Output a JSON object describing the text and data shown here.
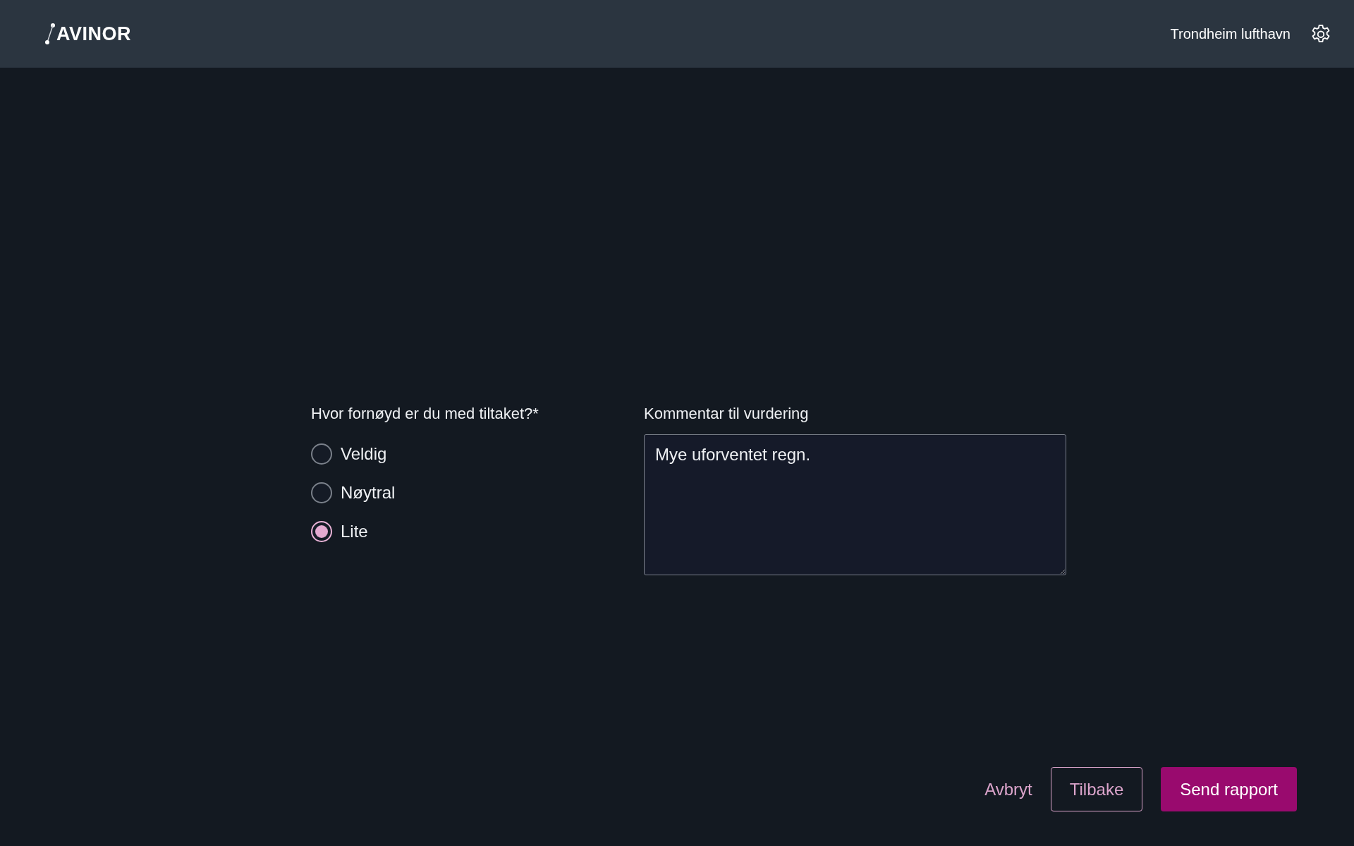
{
  "header": {
    "logo": "AVINOR",
    "location": "Trondheim lufthavn"
  },
  "rating": {
    "label": "Hvor fornøyd er du med tiltaket?*",
    "options": [
      {
        "label": "Veldig",
        "selected": false
      },
      {
        "label": "Nøytral",
        "selected": false
      },
      {
        "label": "Lite",
        "selected": true
      }
    ]
  },
  "comment": {
    "label": "Kommentar til vurdering",
    "value": "Mye uforventet regn."
  },
  "actions": [
    {
      "label": "Avbryt",
      "kind": "link"
    },
    {
      "label": "Tilbake",
      "kind": "outline"
    },
    {
      "label": "Send rapport",
      "kind": "primary"
    }
  ]
}
